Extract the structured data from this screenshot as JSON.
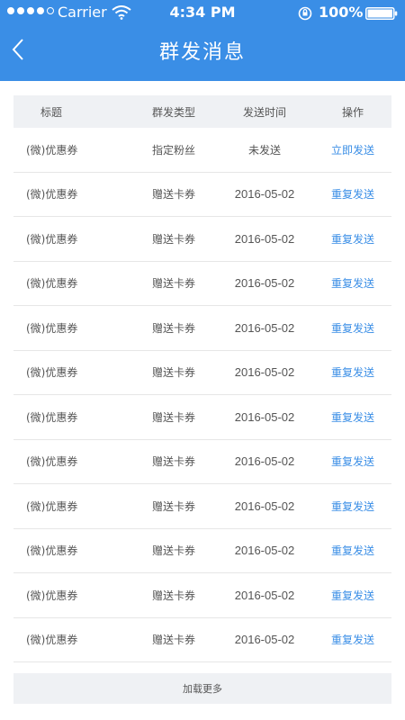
{
  "status_bar": {
    "carrier": "Carrier",
    "time": "4:34 PM",
    "battery": "100%",
    "icons": [
      "signal-icon",
      "wifi-icon",
      "lock-rotation-icon",
      "battery-icon"
    ]
  },
  "header": {
    "title": "群发消息",
    "back_icon": "chevron-left-icon",
    "background_color": "#3a8ee6"
  },
  "table": {
    "columns": [
      "标题",
      "群发类型",
      "发送时间",
      "操作"
    ],
    "rows": [
      {
        "title": "(微)优惠券",
        "type": "指定粉丝",
        "time": "未发送",
        "action": "立即发送"
      },
      {
        "title": "(微)优惠券",
        "type": "赠送卡券",
        "time": "2016-05-02",
        "action": "重复发送"
      },
      {
        "title": "(微)优惠券",
        "type": "赠送卡券",
        "time": "2016-05-02",
        "action": "重复发送"
      },
      {
        "title": "(微)优惠券",
        "type": "赠送卡券",
        "time": "2016-05-02",
        "action": "重复发送"
      },
      {
        "title": "(微)优惠券",
        "type": "赠送卡券",
        "time": "2016-05-02",
        "action": "重复发送"
      },
      {
        "title": "(微)优惠券",
        "type": "赠送卡券",
        "time": "2016-05-02",
        "action": "重复发送"
      },
      {
        "title": "(微)优惠券",
        "type": "赠送卡券",
        "time": "2016-05-02",
        "action": "重复发送"
      },
      {
        "title": "(微)优惠券",
        "type": "赠送卡券",
        "time": "2016-05-02",
        "action": "重复发送"
      },
      {
        "title": "(微)优惠券",
        "type": "赠送卡券",
        "time": "2016-05-02",
        "action": "重复发送"
      },
      {
        "title": "(微)优惠券",
        "type": "赠送卡券",
        "time": "2016-05-02",
        "action": "重复发送"
      },
      {
        "title": "(微)优惠券",
        "type": "赠送卡券",
        "time": "2016-05-02",
        "action": "重复发送"
      },
      {
        "title": "(微)优惠券",
        "type": "赠送卡券",
        "time": "2016-05-02",
        "action": "重复发送"
      }
    ]
  },
  "load_more": "加载更多",
  "colors": {
    "accent": "#3a8ee6",
    "header_bg": "#eff1f4",
    "text": "#555555"
  }
}
